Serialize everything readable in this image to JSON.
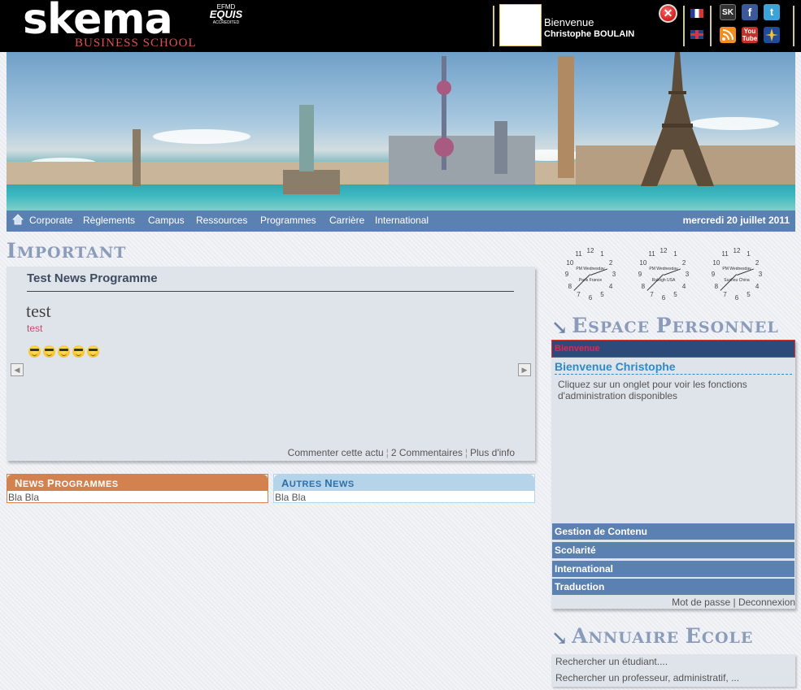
{
  "header": {
    "logo_text": "skema",
    "logo_sub": "BUSINESS SCHOOL",
    "equis_top": "EFMD",
    "equis_main": "EQUIS",
    "equis_bottom": "ACCREDITED",
    "welcome": "Bienvenue",
    "user_name": "Christophe BOULAIN",
    "social": {
      "sk": "SK",
      "facebook": "f",
      "twitter": "t",
      "youtube": "You Tube"
    }
  },
  "nav": {
    "items": [
      "Corporate",
      "Règlements",
      "Campus",
      "Ressources",
      "Programmes",
      "Carrière",
      "International"
    ],
    "date": "mercredi 20 juillet 2011"
  },
  "important": {
    "section_title_cap": "I",
    "section_title_rest": "MPORTANT",
    "title": "Test News Programme",
    "heading": "test",
    "subheading": "test",
    "links": {
      "comment": "Commenter cette actu",
      "comments_count": "2 Commentaires",
      "more": "Plus d'info"
    }
  },
  "news": {
    "programmes": {
      "title_cap1": "N",
      "title_rest1": "EWS ",
      "title_cap2": "P",
      "title_rest2": "ROGRAMMES",
      "body": "Bla Bla"
    },
    "autres": {
      "title_cap1": "A",
      "title_rest1": "UTRES ",
      "title_cap2": "N",
      "title_rest2": "EWS",
      "body": "Bla Bla"
    }
  },
  "clocks": [
    {
      "zone": "Paris France"
    },
    {
      "zone": "Raleigh USA"
    },
    {
      "zone": "Suzhou China"
    }
  ],
  "clock_label_top": "PM",
  "clock_label_day": "Wednesday",
  "espace": {
    "title_cap1": "E",
    "title_rest1": "SPACE ",
    "title_cap2": "P",
    "title_rest2": "ERSONNEL",
    "active_tab": "Bienvenue",
    "greeting": "Bienvenue Christophe",
    "text": "Cliquez sur un onglet pour voir les fonctions d'administration disponibles",
    "tabs": [
      "Gestion de Contenu",
      "Scolarité",
      "International",
      "Traduction"
    ],
    "footer_pwd": "Mot de passe",
    "footer_sep": " | ",
    "footer_logout": "Deconnexion"
  },
  "annuaire": {
    "title_cap1": "A",
    "title_rest1": "NNUAIRE ",
    "title_cap2": "E",
    "title_rest2": "COLE",
    "search_student": "Rechercher un étudiant....",
    "search_staff": "Rechercher un professeur, administratif, ..."
  },
  "colors": {
    "nav_blue": "#5b80b2",
    "news_orange": "#d3814f",
    "news_light_blue": "#b6d4e9",
    "title_gray_blue": "#8a9cb9",
    "active_tab_red": "#e0284b"
  }
}
